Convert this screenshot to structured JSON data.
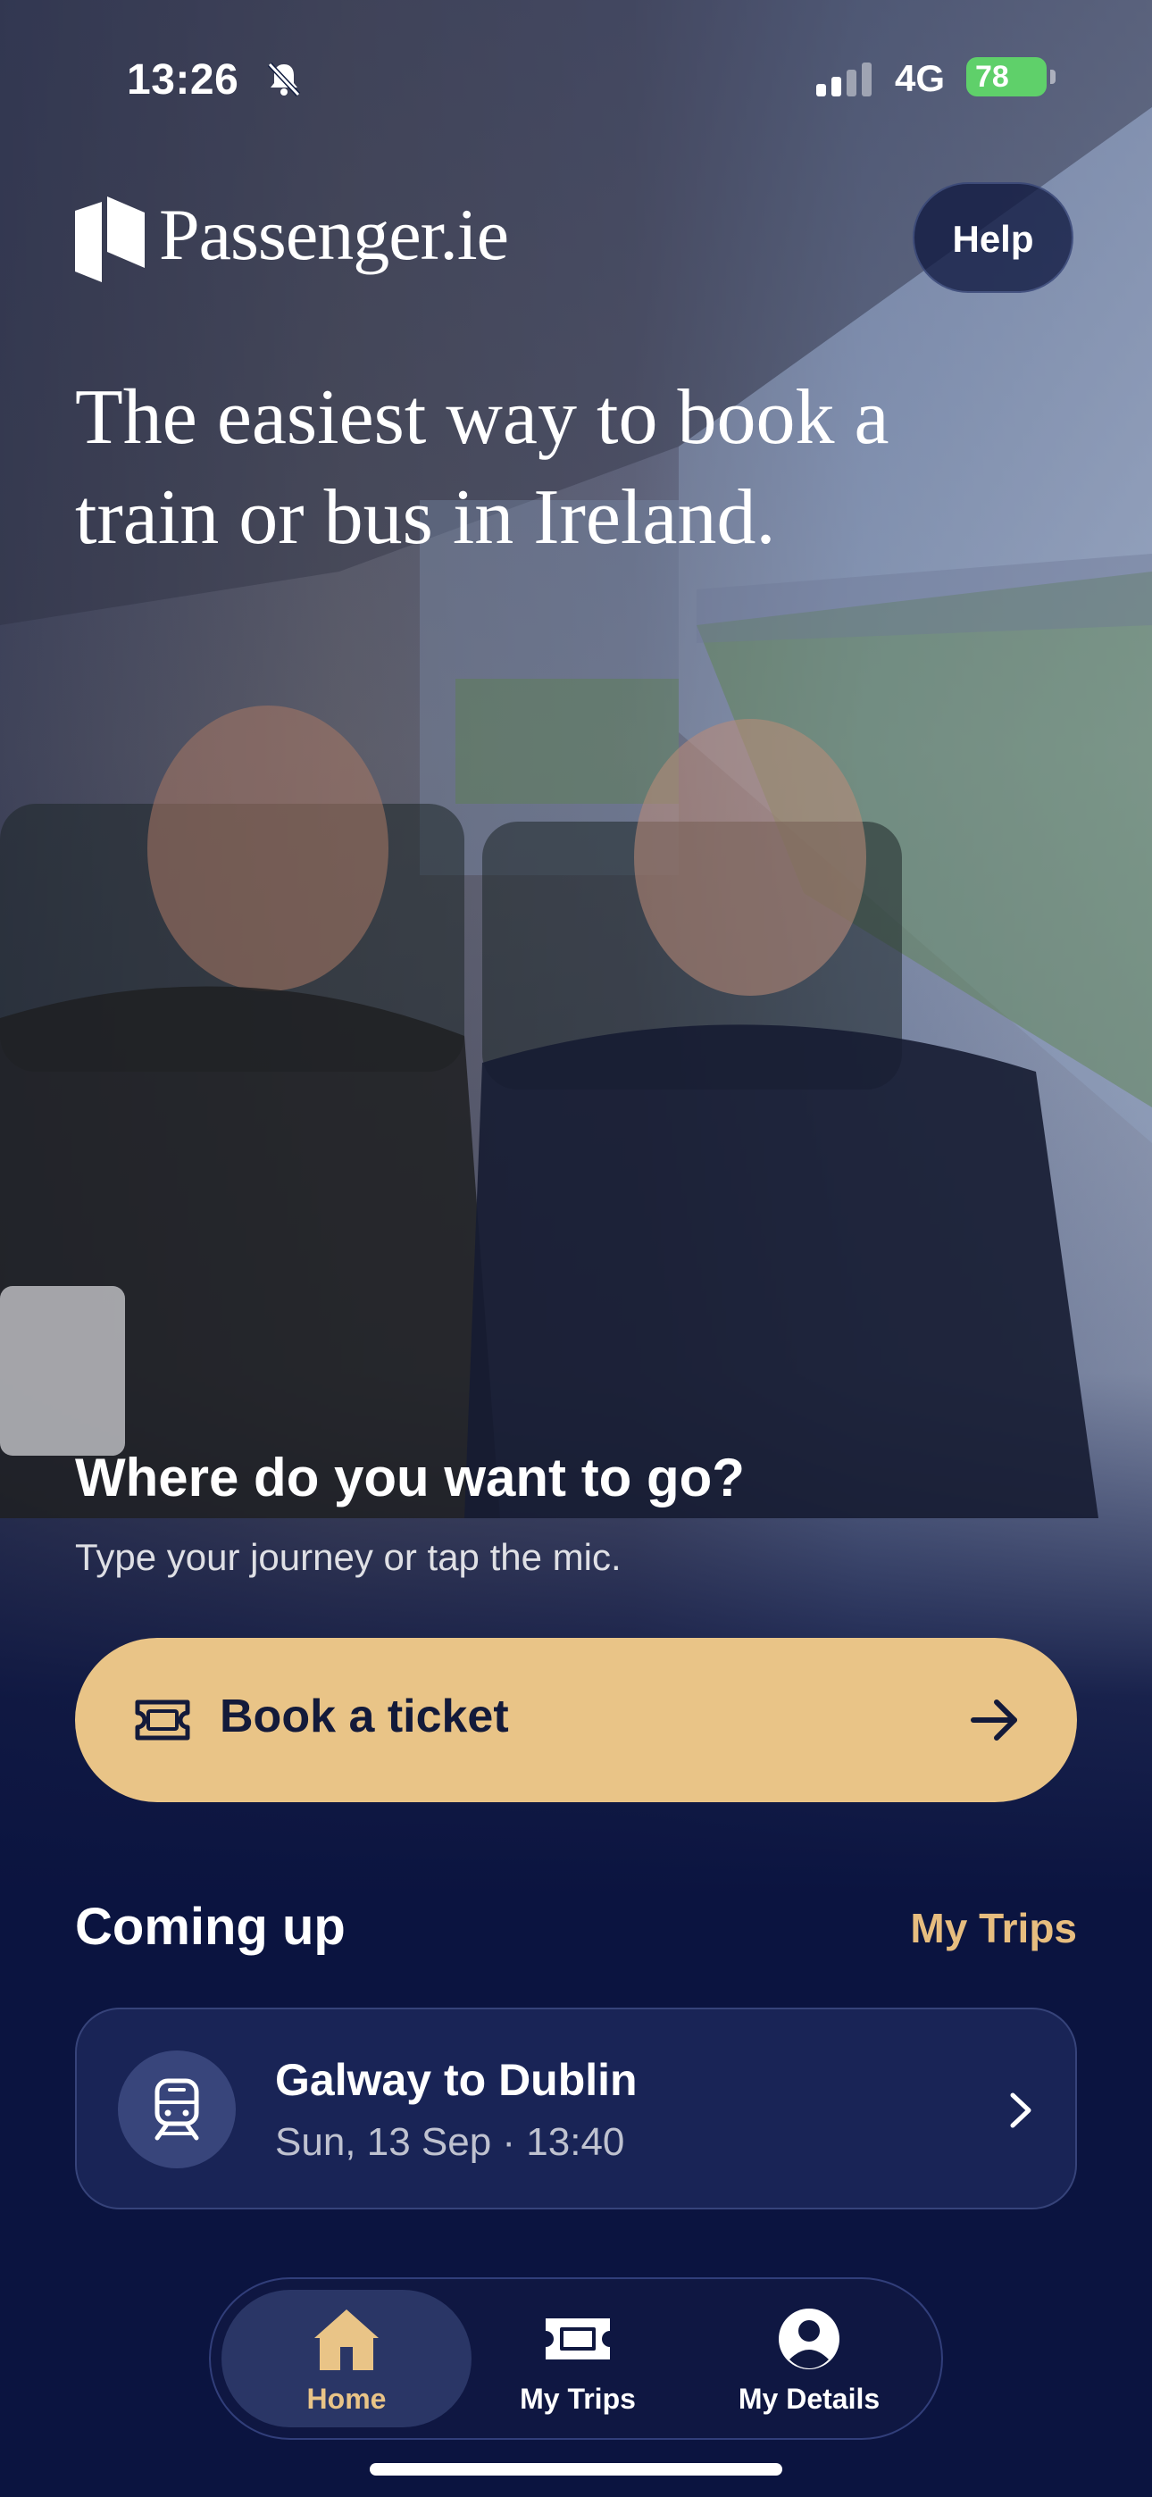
{
  "status_bar": {
    "time": "13:26",
    "network": "4G",
    "battery": "78"
  },
  "header": {
    "brand": "Passenger.ie",
    "help_label": "Help"
  },
  "hero": {
    "headline": "The easiest way to book a train or bus in Ireland."
  },
  "search": {
    "title": "Where do you want to go?",
    "subtitle": "Type your journey or tap the mic.",
    "book_label": "Book a ticket"
  },
  "upcoming": {
    "title": "Coming up",
    "link_label": "My Trips",
    "trip": {
      "route": "Galway to Dublin",
      "when": "Sun, 13 Sep · 13:40"
    }
  },
  "tabbar": {
    "items": [
      {
        "label": "Home",
        "icon": "home-icon",
        "active": true
      },
      {
        "label": "My Trips",
        "icon": "ticket-icon",
        "active": false
      },
      {
        "label": "My Details",
        "icon": "user-icon",
        "active": false
      }
    ]
  },
  "colors": {
    "accent": "#e9c487",
    "link": "#e7bd7f",
    "background": "#0b1440",
    "battery": "#5fd06a"
  }
}
